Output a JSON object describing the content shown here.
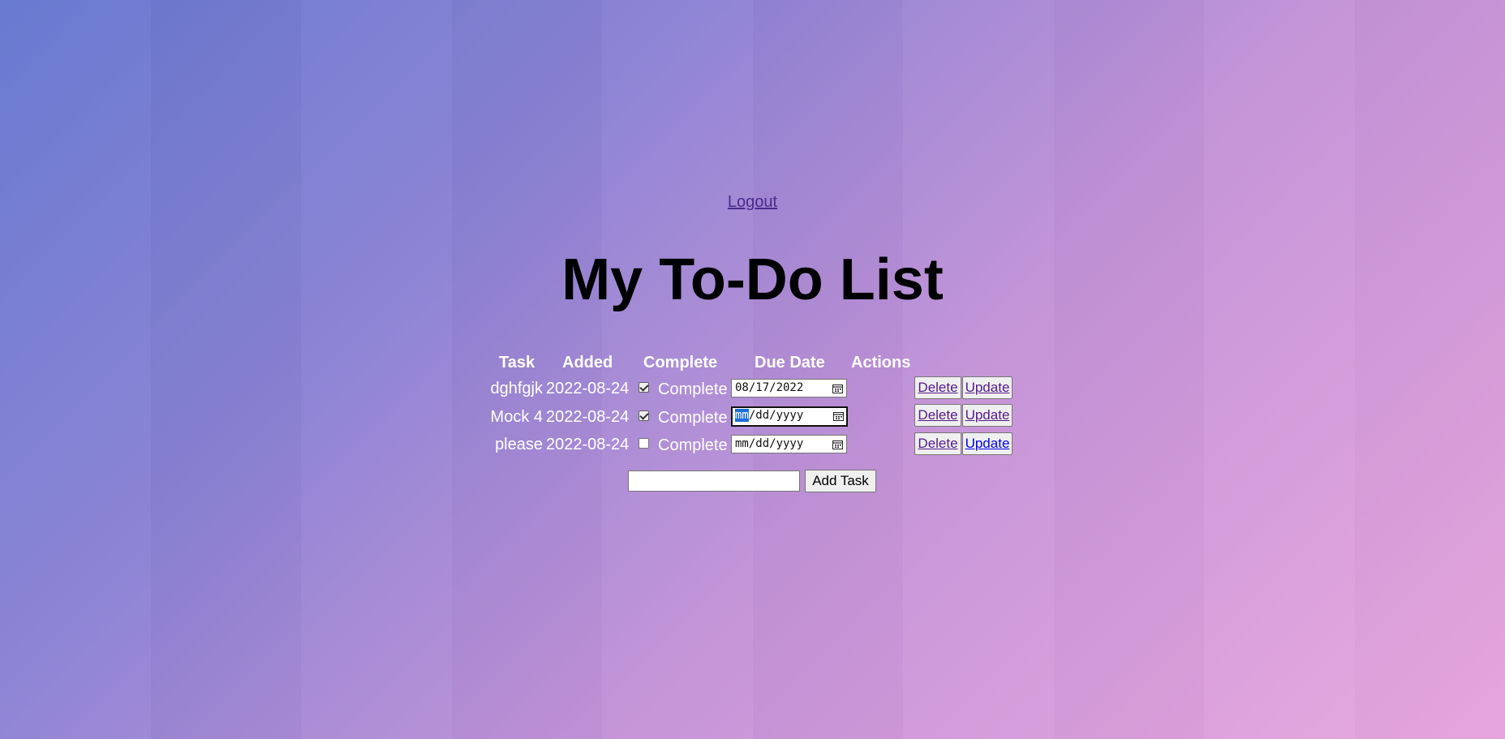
{
  "header": {
    "logout_label": "Logout",
    "title": "My To-Do List"
  },
  "table": {
    "columns": [
      "Task",
      "Added",
      "Complete",
      "Due Date",
      "Actions"
    ],
    "rows": [
      {
        "task": "dghfgjk",
        "added": "2022-08-24",
        "completed": true,
        "complete_label": "Complete",
        "due_date": "08/17/2022",
        "due_date_focused": false,
        "delete_label": "Delete",
        "update_label": "Update"
      },
      {
        "task": "Mock 4",
        "added": "2022-08-24",
        "completed": true,
        "complete_label": "Complete",
        "due_date_placeholder_month": "mm",
        "due_date_placeholder_rest": "/dd/yyyy",
        "due_date_focused": true,
        "delete_label": "Delete",
        "update_label": "Update"
      },
      {
        "task": "please",
        "added": "2022-08-24",
        "completed": false,
        "complete_label": "Complete",
        "due_date_placeholder": "mm/dd/yyyy",
        "due_date_focused": false,
        "delete_label": "Delete",
        "update_label": "Update"
      }
    ]
  },
  "new_task": {
    "value": "",
    "add_label": "Add Task"
  },
  "icons": {
    "calendar": "calendar-icon",
    "checkbox": "checkbox-icon"
  },
  "colors": {
    "link_visited": "#551a8b",
    "link": "#0000ee",
    "focus_highlight": "#1a6fd6"
  }
}
